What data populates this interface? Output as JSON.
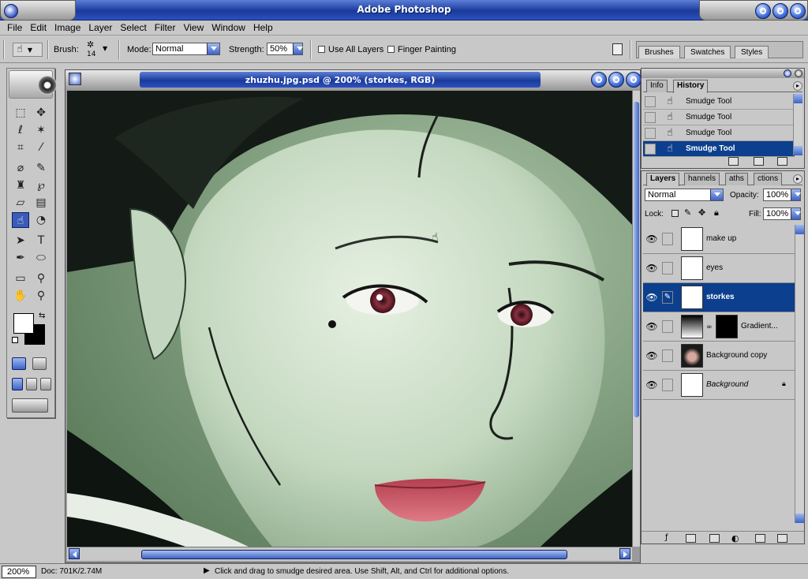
{
  "app": {
    "title": "Adobe Photoshop"
  },
  "menu": [
    "File",
    "Edit",
    "Image",
    "Layer",
    "Select",
    "Filter",
    "View",
    "Window",
    "Help"
  ],
  "options": {
    "brush_label": "Brush:",
    "brush_size": "14",
    "mode_label": "Mode:",
    "mode_value": "Normal",
    "strength_label": "Strength:",
    "strength_value": "50%",
    "use_all_layers": "Use All Layers",
    "finger_painting": "Finger Painting"
  },
  "palette_well": {
    "tabs": [
      "Brushes",
      "Swatches",
      "Styles"
    ]
  },
  "document": {
    "title": "zhuzhu.jpg.psd @ 200% (storkes, RGB)"
  },
  "history": {
    "tabs": [
      "Info",
      "History"
    ],
    "items": [
      {
        "label": "Smudge Tool",
        "selected": false
      },
      {
        "label": "Smudge Tool",
        "selected": false
      },
      {
        "label": "Smudge Tool",
        "selected": false
      },
      {
        "label": "Smudge Tool",
        "selected": true
      }
    ]
  },
  "layers": {
    "tabs": [
      "Layers",
      "hannels",
      "aths",
      "ctions"
    ],
    "blend_mode": "Normal",
    "opacity_label": "Opacity:",
    "opacity_value": "100%",
    "lock_label": "Lock:",
    "fill_label": "Fill:",
    "fill_value": "100%",
    "items": [
      {
        "name": "make up",
        "thumb": "transparent",
        "selected": false
      },
      {
        "name": "eyes",
        "thumb": "transparent",
        "selected": false
      },
      {
        "name": "storkes",
        "thumb": "transparent",
        "selected": true
      },
      {
        "name": "Gradient...",
        "thumb": "gradient",
        "selected": false
      },
      {
        "name": "Background copy",
        "thumb": "photo",
        "selected": false
      },
      {
        "name": "Background",
        "thumb": "white",
        "selected": false
      }
    ]
  },
  "status": {
    "zoom": "200%",
    "doc_info": "Doc: 701K/2.74M",
    "message": "Click and drag to smudge desired area.  Use Shift, Alt, and Ctrl for additional options."
  },
  "colors": {
    "accent_blue": "#1b3a9a",
    "selection_blue": "#0c3f8e",
    "canvas_green": "#6d8e6d",
    "chrome_grey": "#c8c8c8"
  }
}
